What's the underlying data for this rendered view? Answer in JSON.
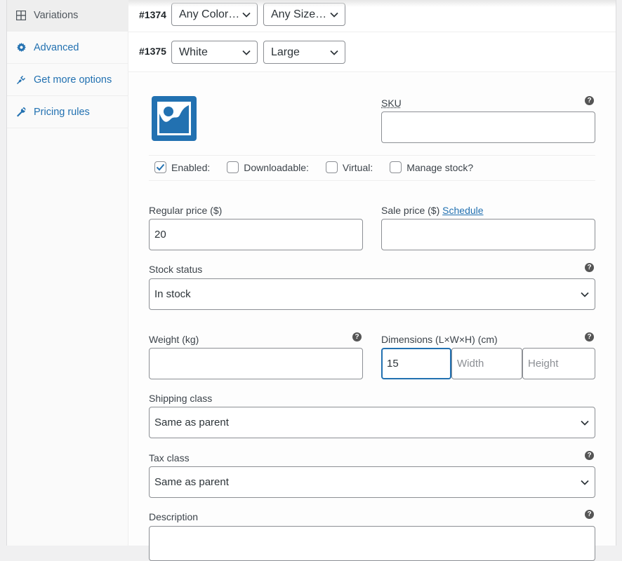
{
  "sidebar": {
    "items": [
      {
        "label": "Variations",
        "icon": "grid-icon",
        "active": true
      },
      {
        "label": "Advanced",
        "icon": "gear-icon"
      },
      {
        "label": "Get more options",
        "icon": "plug-icon"
      },
      {
        "label": "Pricing rules",
        "icon": "wrench-icon"
      }
    ]
  },
  "variations": [
    {
      "id": "#1374",
      "color": "Any Color…",
      "size": "Any Size…"
    },
    {
      "id": "#1375",
      "color": "White",
      "size": "Large"
    }
  ],
  "form": {
    "image_icon": "image-placeholder-icon",
    "sku": {
      "label": "SKU",
      "value": ""
    },
    "checkboxes": [
      {
        "label": "Enabled:",
        "checked": true
      },
      {
        "label": "Downloadable:",
        "checked": false
      },
      {
        "label": "Virtual:",
        "checked": false
      },
      {
        "label": "Manage stock?",
        "checked": false
      }
    ],
    "regular_price": {
      "label": "Regular price ($)",
      "value": "20"
    },
    "sale_price": {
      "label": "Sale price ($)",
      "link": "Schedule",
      "value": ""
    },
    "stock_status": {
      "label": "Stock status",
      "value": "In stock"
    },
    "weight": {
      "label": "Weight (kg)",
      "value": ""
    },
    "dimensions": {
      "label": "Dimensions (L×W×H) (cm)",
      "length": "15",
      "width_placeholder": "Width",
      "height_placeholder": "Height"
    },
    "shipping_class": {
      "label": "Shipping class",
      "value": "Same as parent"
    },
    "tax_class": {
      "label": "Tax class",
      "value": "Same as parent"
    },
    "description": {
      "label": "Description",
      "value": ""
    },
    "help_glyph": "?"
  },
  "colors": {
    "accent": "#2271b1",
    "icon_blue": "#2271b1"
  }
}
